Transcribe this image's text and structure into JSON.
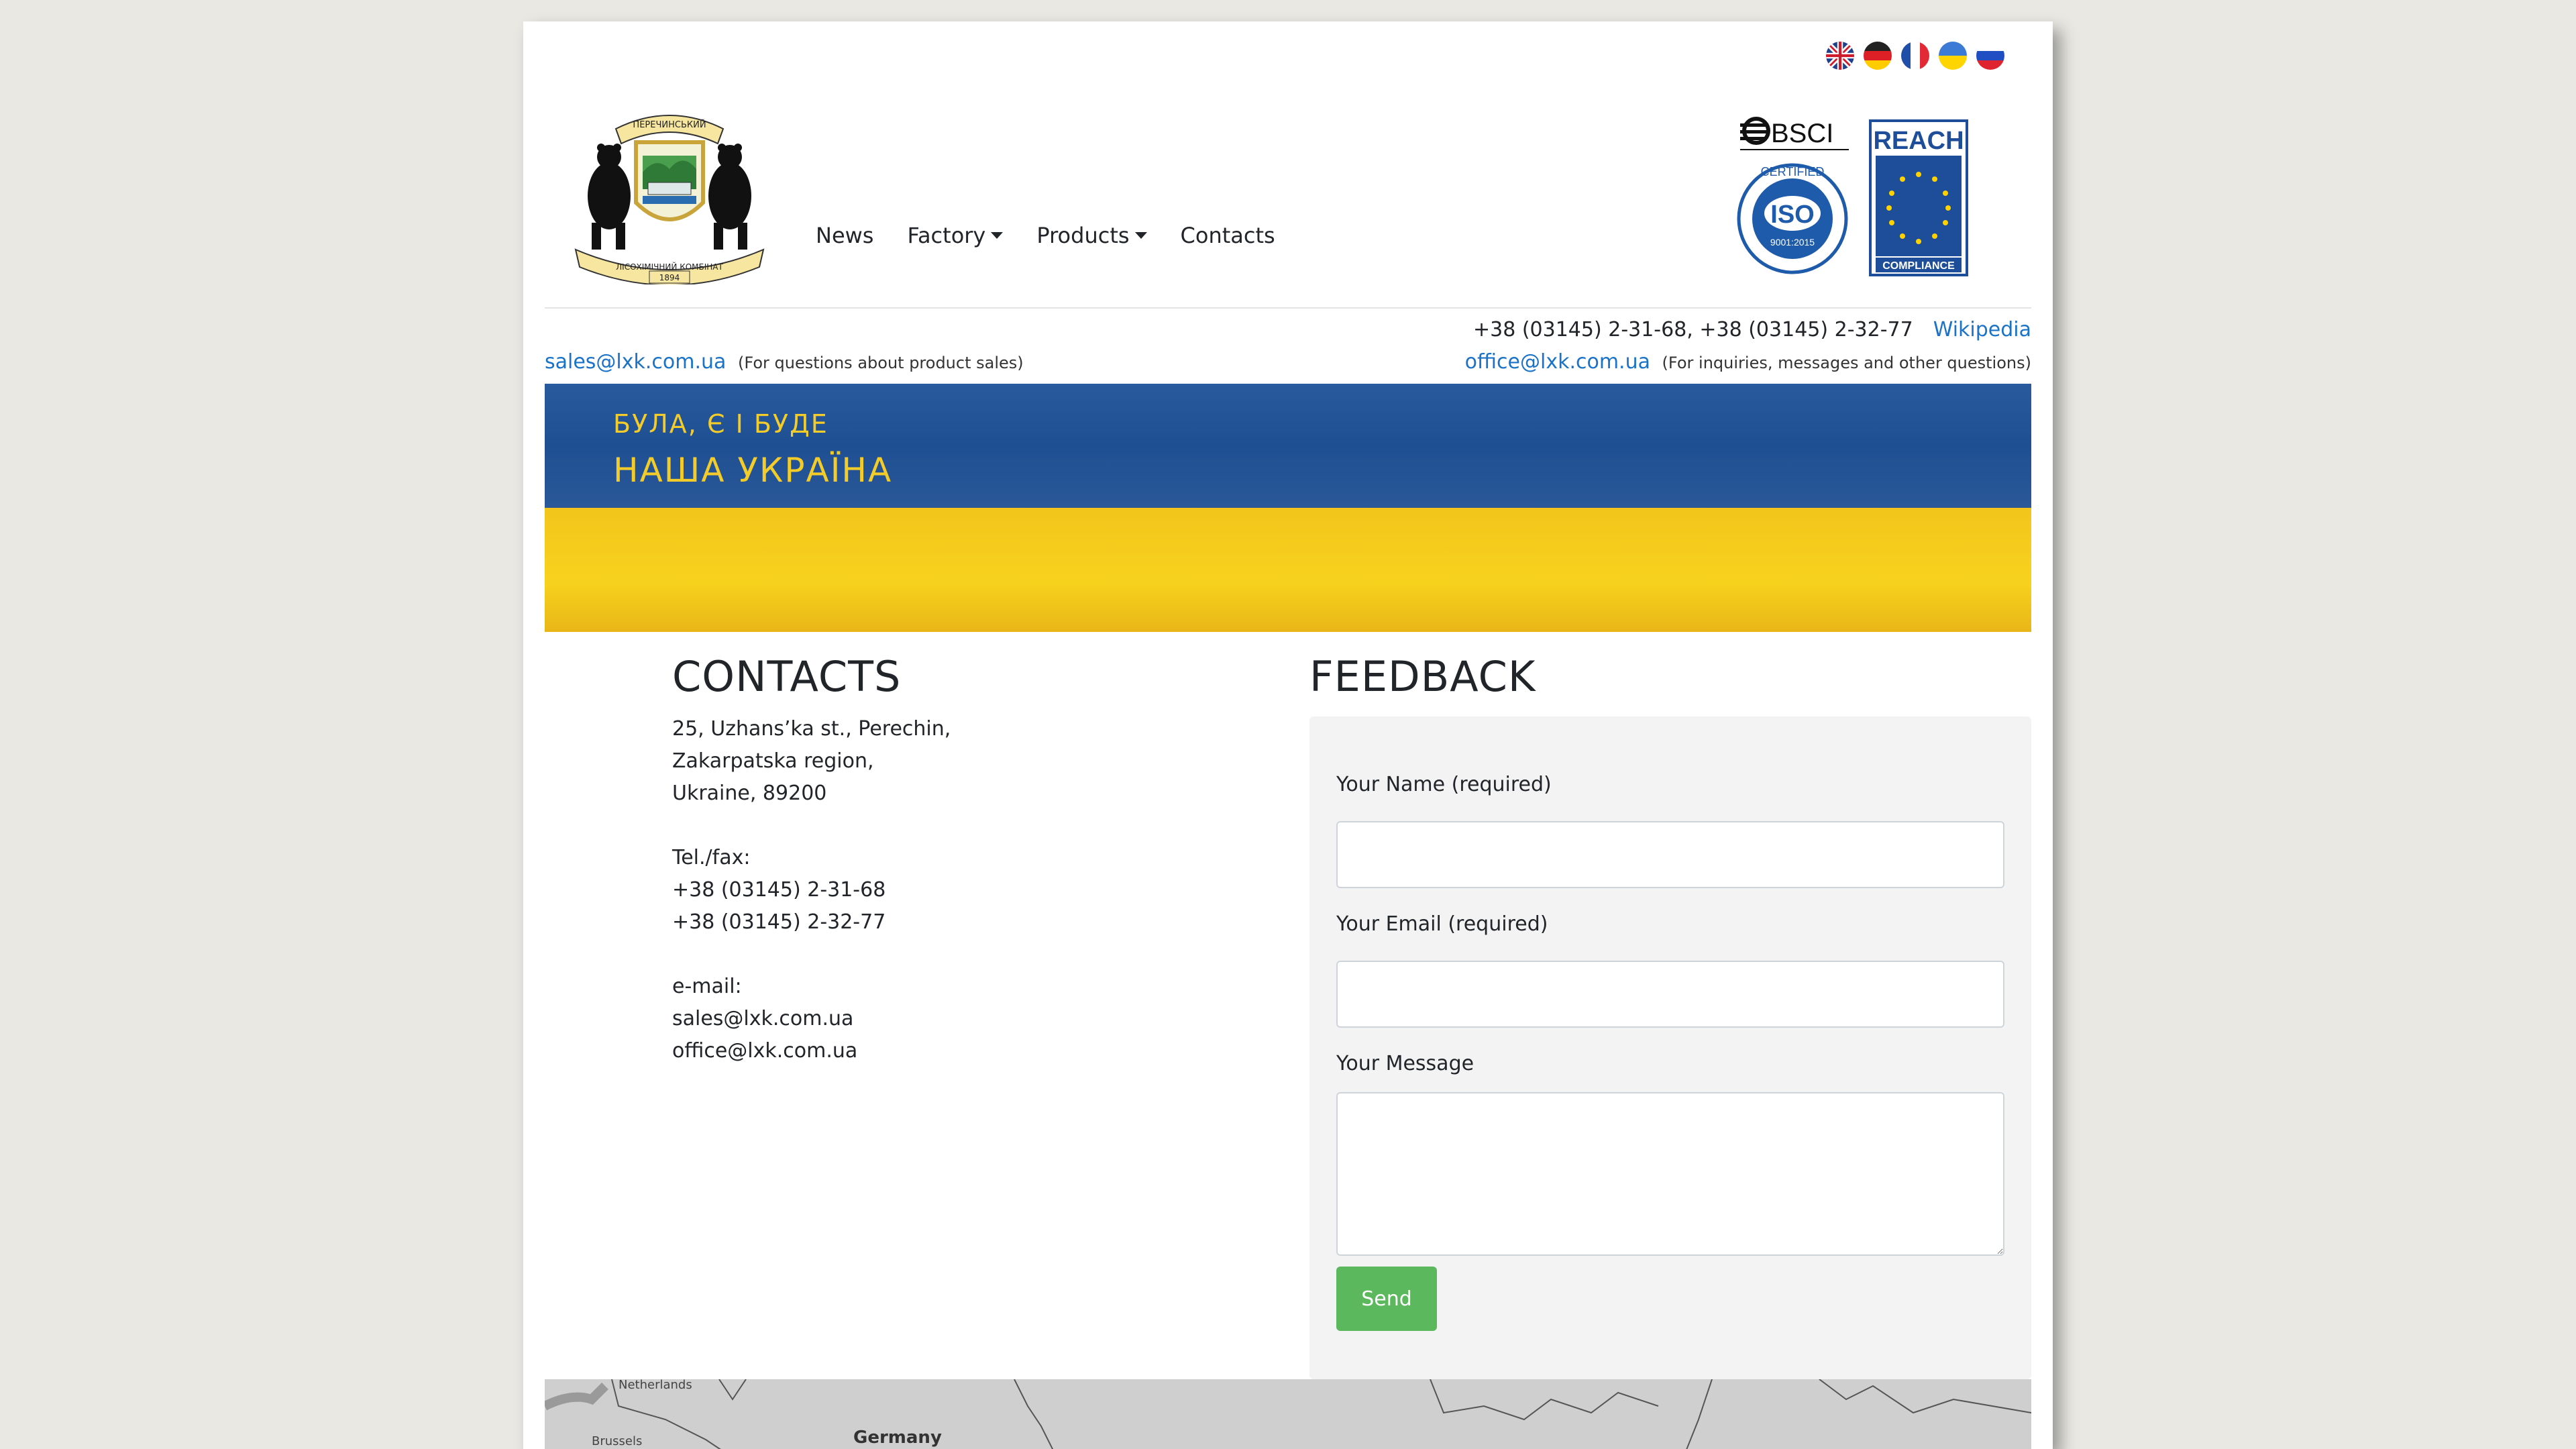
{
  "language_flags": [
    {
      "name": "en-flag-icon"
    },
    {
      "name": "de-flag-icon"
    },
    {
      "name": "fr-flag-icon"
    },
    {
      "name": "ua-flag-icon"
    },
    {
      "name": "ru-flag-icon"
    }
  ],
  "logo": {
    "top_text": "ПЕРЕЧИНСЬКИЙ",
    "bottom_text": "ЛІСОХІМІЧНИЙ КОМБІНАТ",
    "year": "1894"
  },
  "nav": {
    "news": "News",
    "factory": "Factory",
    "products": "Products",
    "contacts": "Contacts"
  },
  "certs": {
    "bsci": "BSCI",
    "iso_top": "CERTIFIED",
    "iso_main": "ISO",
    "iso_sub": "9001:2015",
    "reach_title": "REACH",
    "reach_bottom": "COMPLIANCE"
  },
  "header_info": {
    "phones": "+38 (03145) 2-31-68, +38 (03145) 2-32-77",
    "wikipedia": "Wikipedia",
    "sales_email": "sales@lxk.com.ua",
    "sales_note": "(For questions about product sales)",
    "office_email": "office@lxk.com.ua",
    "office_note": "(For inquiries, messages and other questions)"
  },
  "banner": {
    "line1": "БУЛА, Є І БУДЕ",
    "line2": "НАША УКРАЇНА"
  },
  "contacts": {
    "title": "CONTACTS",
    "address1": "25, Uzhans’ka st., Perechin,",
    "address2": "Zakarpatska region,",
    "address3": "Ukraine, 89200",
    "tel_label": "Tel./fax:",
    "tel1": "+38 (03145) 2-31-68",
    "tel2": "+38 (03145) 2-32-77",
    "email_label": "e-mail:",
    "email1": "sales@lxk.com.ua",
    "email2": "office@lxk.com.ua"
  },
  "feedback": {
    "title": "FEEDBACK",
    "name_label": "Your Name (required)",
    "email_label": "Your Email (required)",
    "message_label": "Your Message",
    "send": "Send"
  },
  "map": {
    "label1": "Netherlands",
    "label2": "Brussels",
    "label3": "Germany"
  },
  "colors": {
    "link": "#1a73c8",
    "send_button": "#5cb85c",
    "banner_blue": "#1f4f93",
    "banner_yellow": "#f7d21d"
  }
}
